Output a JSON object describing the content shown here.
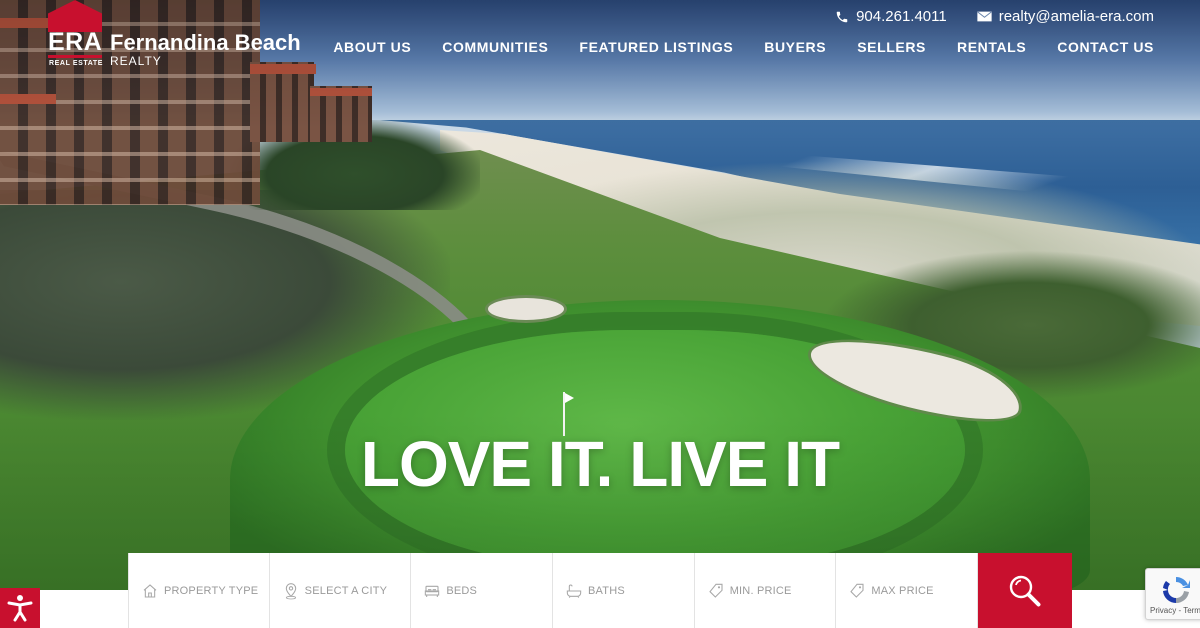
{
  "brand": {
    "mark": "ERA",
    "mark_sub": "REAL ESTATE",
    "name": "Fernandina Beach",
    "realty": "REALTY",
    "accent": "#c8102e"
  },
  "contact": {
    "phone": "904.261.4011",
    "phone_icon": "phone-icon",
    "email": "realty@amelia-era.com",
    "email_icon": "envelope-icon"
  },
  "nav": {
    "items": [
      {
        "label": "ABOUT US"
      },
      {
        "label": "COMMUNITIES"
      },
      {
        "label": "FEATURED LISTINGS"
      },
      {
        "label": "BUYERS"
      },
      {
        "label": "SELLERS"
      },
      {
        "label": "RENTALS"
      },
      {
        "label": "CONTACT US"
      }
    ]
  },
  "hero": {
    "headline": "LOVE IT. LIVE IT"
  },
  "search": {
    "fields": [
      {
        "label": "PROPERTY TYPE",
        "icon": "home-icon"
      },
      {
        "label": "SELECT A CITY",
        "icon": "map-pin-icon"
      },
      {
        "label": "BEDS",
        "icon": "bed-icon"
      },
      {
        "label": "BATHS",
        "icon": "bathtub-icon"
      },
      {
        "label": "MIN. PRICE",
        "icon": "price-tag-icon"
      },
      {
        "label": "MAX PRICE",
        "icon": "price-tag-icon"
      }
    ],
    "button_icon": "search-icon"
  },
  "widgets": {
    "accessibility_icon": "accessibility-icon",
    "recaptcha_links": "Privacy - Terms"
  }
}
